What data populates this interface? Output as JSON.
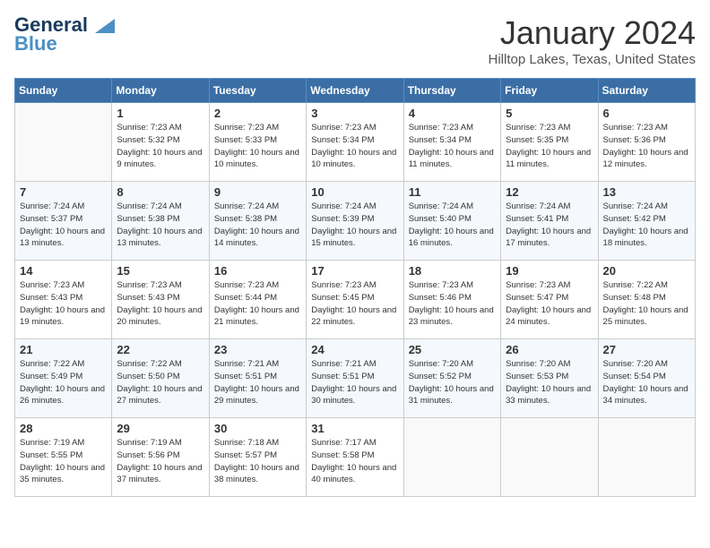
{
  "header": {
    "logo_line1": "General",
    "logo_line2": "Blue",
    "month_title": "January 2024",
    "location": "Hilltop Lakes, Texas, United States"
  },
  "days_of_week": [
    "Sunday",
    "Monday",
    "Tuesday",
    "Wednesday",
    "Thursday",
    "Friday",
    "Saturday"
  ],
  "weeks": [
    [
      {
        "day": "",
        "sunrise": "",
        "sunset": "",
        "daylight": ""
      },
      {
        "day": "1",
        "sunrise": "Sunrise: 7:23 AM",
        "sunset": "Sunset: 5:32 PM",
        "daylight": "Daylight: 10 hours and 9 minutes."
      },
      {
        "day": "2",
        "sunrise": "Sunrise: 7:23 AM",
        "sunset": "Sunset: 5:33 PM",
        "daylight": "Daylight: 10 hours and 10 minutes."
      },
      {
        "day": "3",
        "sunrise": "Sunrise: 7:23 AM",
        "sunset": "Sunset: 5:34 PM",
        "daylight": "Daylight: 10 hours and 10 minutes."
      },
      {
        "day": "4",
        "sunrise": "Sunrise: 7:23 AM",
        "sunset": "Sunset: 5:34 PM",
        "daylight": "Daylight: 10 hours and 11 minutes."
      },
      {
        "day": "5",
        "sunrise": "Sunrise: 7:23 AM",
        "sunset": "Sunset: 5:35 PM",
        "daylight": "Daylight: 10 hours and 11 minutes."
      },
      {
        "day": "6",
        "sunrise": "Sunrise: 7:23 AM",
        "sunset": "Sunset: 5:36 PM",
        "daylight": "Daylight: 10 hours and 12 minutes."
      }
    ],
    [
      {
        "day": "7",
        "sunrise": "Sunrise: 7:24 AM",
        "sunset": "Sunset: 5:37 PM",
        "daylight": "Daylight: 10 hours and 13 minutes."
      },
      {
        "day": "8",
        "sunrise": "Sunrise: 7:24 AM",
        "sunset": "Sunset: 5:38 PM",
        "daylight": "Daylight: 10 hours and 13 minutes."
      },
      {
        "day": "9",
        "sunrise": "Sunrise: 7:24 AM",
        "sunset": "Sunset: 5:38 PM",
        "daylight": "Daylight: 10 hours and 14 minutes."
      },
      {
        "day": "10",
        "sunrise": "Sunrise: 7:24 AM",
        "sunset": "Sunset: 5:39 PM",
        "daylight": "Daylight: 10 hours and 15 minutes."
      },
      {
        "day": "11",
        "sunrise": "Sunrise: 7:24 AM",
        "sunset": "Sunset: 5:40 PM",
        "daylight": "Daylight: 10 hours and 16 minutes."
      },
      {
        "day": "12",
        "sunrise": "Sunrise: 7:24 AM",
        "sunset": "Sunset: 5:41 PM",
        "daylight": "Daylight: 10 hours and 17 minutes."
      },
      {
        "day": "13",
        "sunrise": "Sunrise: 7:24 AM",
        "sunset": "Sunset: 5:42 PM",
        "daylight": "Daylight: 10 hours and 18 minutes."
      }
    ],
    [
      {
        "day": "14",
        "sunrise": "Sunrise: 7:23 AM",
        "sunset": "Sunset: 5:43 PM",
        "daylight": "Daylight: 10 hours and 19 minutes."
      },
      {
        "day": "15",
        "sunrise": "Sunrise: 7:23 AM",
        "sunset": "Sunset: 5:43 PM",
        "daylight": "Daylight: 10 hours and 20 minutes."
      },
      {
        "day": "16",
        "sunrise": "Sunrise: 7:23 AM",
        "sunset": "Sunset: 5:44 PM",
        "daylight": "Daylight: 10 hours and 21 minutes."
      },
      {
        "day": "17",
        "sunrise": "Sunrise: 7:23 AM",
        "sunset": "Sunset: 5:45 PM",
        "daylight": "Daylight: 10 hours and 22 minutes."
      },
      {
        "day": "18",
        "sunrise": "Sunrise: 7:23 AM",
        "sunset": "Sunset: 5:46 PM",
        "daylight": "Daylight: 10 hours and 23 minutes."
      },
      {
        "day": "19",
        "sunrise": "Sunrise: 7:23 AM",
        "sunset": "Sunset: 5:47 PM",
        "daylight": "Daylight: 10 hours and 24 minutes."
      },
      {
        "day": "20",
        "sunrise": "Sunrise: 7:22 AM",
        "sunset": "Sunset: 5:48 PM",
        "daylight": "Daylight: 10 hours and 25 minutes."
      }
    ],
    [
      {
        "day": "21",
        "sunrise": "Sunrise: 7:22 AM",
        "sunset": "Sunset: 5:49 PM",
        "daylight": "Daylight: 10 hours and 26 minutes."
      },
      {
        "day": "22",
        "sunrise": "Sunrise: 7:22 AM",
        "sunset": "Sunset: 5:50 PM",
        "daylight": "Daylight: 10 hours and 27 minutes."
      },
      {
        "day": "23",
        "sunrise": "Sunrise: 7:21 AM",
        "sunset": "Sunset: 5:51 PM",
        "daylight": "Daylight: 10 hours and 29 minutes."
      },
      {
        "day": "24",
        "sunrise": "Sunrise: 7:21 AM",
        "sunset": "Sunset: 5:51 PM",
        "daylight": "Daylight: 10 hours and 30 minutes."
      },
      {
        "day": "25",
        "sunrise": "Sunrise: 7:20 AM",
        "sunset": "Sunset: 5:52 PM",
        "daylight": "Daylight: 10 hours and 31 minutes."
      },
      {
        "day": "26",
        "sunrise": "Sunrise: 7:20 AM",
        "sunset": "Sunset: 5:53 PM",
        "daylight": "Daylight: 10 hours and 33 minutes."
      },
      {
        "day": "27",
        "sunrise": "Sunrise: 7:20 AM",
        "sunset": "Sunset: 5:54 PM",
        "daylight": "Daylight: 10 hours and 34 minutes."
      }
    ],
    [
      {
        "day": "28",
        "sunrise": "Sunrise: 7:19 AM",
        "sunset": "Sunset: 5:55 PM",
        "daylight": "Daylight: 10 hours and 35 minutes."
      },
      {
        "day": "29",
        "sunrise": "Sunrise: 7:19 AM",
        "sunset": "Sunset: 5:56 PM",
        "daylight": "Daylight: 10 hours and 37 minutes."
      },
      {
        "day": "30",
        "sunrise": "Sunrise: 7:18 AM",
        "sunset": "Sunset: 5:57 PM",
        "daylight": "Daylight: 10 hours and 38 minutes."
      },
      {
        "day": "31",
        "sunrise": "Sunrise: 7:17 AM",
        "sunset": "Sunset: 5:58 PM",
        "daylight": "Daylight: 10 hours and 40 minutes."
      },
      {
        "day": "",
        "sunrise": "",
        "sunset": "",
        "daylight": ""
      },
      {
        "day": "",
        "sunrise": "",
        "sunset": "",
        "daylight": ""
      },
      {
        "day": "",
        "sunrise": "",
        "sunset": "",
        "daylight": ""
      }
    ]
  ]
}
